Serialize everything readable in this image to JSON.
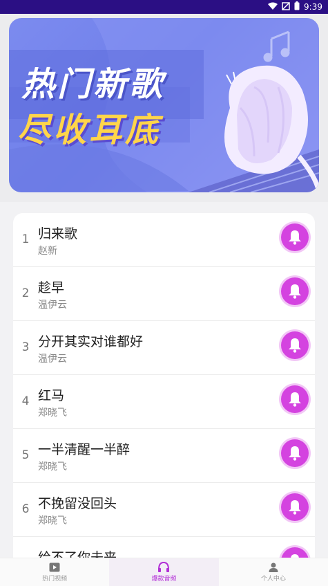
{
  "status_bar": {
    "time": "9:39",
    "icons": [
      "wifi-icon",
      "signal-off-icon",
      "battery-icon"
    ]
  },
  "banner": {
    "line1": "热门新歌",
    "line2": "尽收耳底"
  },
  "songs": [
    {
      "rank": "1",
      "title": "归来歌",
      "artist": "赵新"
    },
    {
      "rank": "2",
      "title": "趁早",
      "artist": "温伊云"
    },
    {
      "rank": "3",
      "title": "分开其实对谁都好",
      "artist": "温伊云"
    },
    {
      "rank": "4",
      "title": "红马",
      "artist": "郑晓飞"
    },
    {
      "rank": "5",
      "title": "一半清醒一半醉",
      "artist": "郑晓飞"
    },
    {
      "rank": "6",
      "title": "不挽留没回头",
      "artist": "郑晓飞"
    },
    {
      "rank": "7",
      "title": "给不了你未来",
      "artist": ""
    }
  ],
  "bottom_nav": [
    {
      "label": "热门视频",
      "icon": "video-icon",
      "active": false
    },
    {
      "label": "爆款音频",
      "icon": "headphones-icon",
      "active": true
    },
    {
      "label": "个人中心",
      "icon": "person-icon",
      "active": false
    }
  ],
  "colors": {
    "accent": "#d443e0",
    "status_bar": "#2b0f84",
    "banner_bg": "#7c8bef",
    "banner_highlight": "#ffd54a"
  }
}
